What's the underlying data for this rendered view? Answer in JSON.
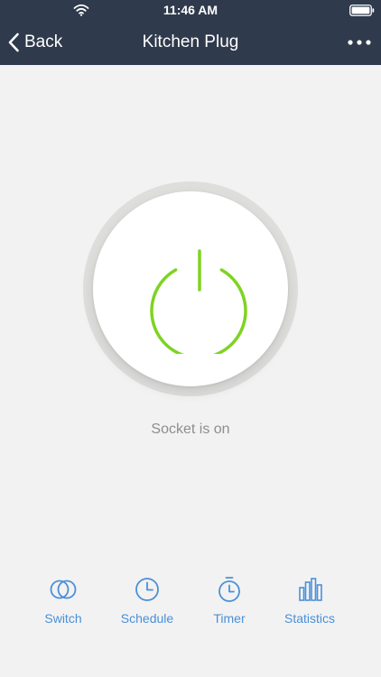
{
  "status_bar": {
    "time": "11:46 AM"
  },
  "nav": {
    "back_label": "Back",
    "title": "Kitchen Plug"
  },
  "device": {
    "status_text": "Socket is on",
    "power_color": "#7ed321"
  },
  "tabs": [
    {
      "label": "Switch",
      "icon": "switch-icon"
    },
    {
      "label": "Schedule",
      "icon": "clock-icon"
    },
    {
      "label": "Timer",
      "icon": "stopwatch-icon"
    },
    {
      "label": "Statistics",
      "icon": "bar-chart-icon"
    }
  ],
  "colors": {
    "header_bg": "#2f3a4c",
    "accent": "#4a90d9",
    "background": "#f2f2f2"
  }
}
